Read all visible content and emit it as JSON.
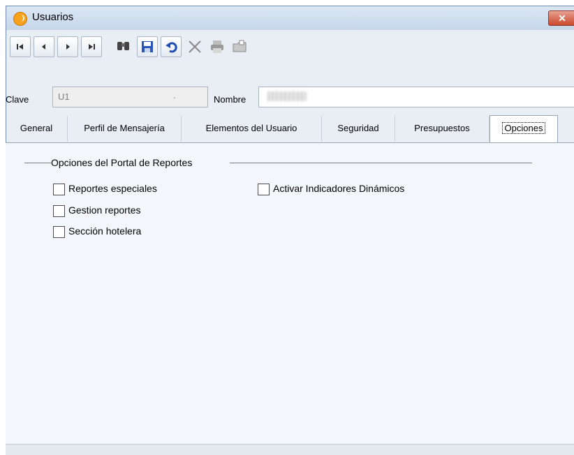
{
  "window": {
    "title": "Usuarios",
    "close_glyph": "✕"
  },
  "toolbar": {
    "buttons": [
      {
        "name": "first-record",
        "icon": "first-icon"
      },
      {
        "name": "previous-record",
        "icon": "previous-icon"
      },
      {
        "name": "next-record",
        "icon": "next-icon"
      },
      {
        "name": "last-record",
        "icon": "last-icon"
      },
      {
        "name": "search",
        "icon": "binoculars-icon"
      },
      {
        "name": "save",
        "icon": "floppy-icon"
      },
      {
        "name": "undo",
        "icon": "undo-icon"
      },
      {
        "name": "delete",
        "icon": "x-icon"
      },
      {
        "name": "print",
        "icon": "printer-icon"
      },
      {
        "name": "open",
        "icon": "folder-icon"
      }
    ]
  },
  "fields": {
    "clave": {
      "label": "Clave",
      "value": "U1",
      "dot": "."
    },
    "nombre": {
      "label": "Nombre",
      "value": ""
    }
  },
  "tabs": [
    {
      "label": "General"
    },
    {
      "label": "Perfil de Mensajería"
    },
    {
      "label": "Elementos del Usuario"
    },
    {
      "label": "Seguridad"
    },
    {
      "label": "Presupuestos"
    },
    {
      "label": "Opciones",
      "active": true
    }
  ],
  "options_group": {
    "title": "Opciones del Portal de Reportes",
    "checkboxes": [
      {
        "label": "Reportes especiales",
        "checked": false
      },
      {
        "label": "Gestion reportes",
        "checked": false
      },
      {
        "label": "Sección hotelera",
        "checked": false
      },
      {
        "label": "Activar Indicadores Dinámicos",
        "checked": false
      }
    ]
  },
  "colors": {
    "close_button": "#c9472d",
    "title_bar": "#c6d7ea",
    "panel": "#f3f6fa"
  }
}
